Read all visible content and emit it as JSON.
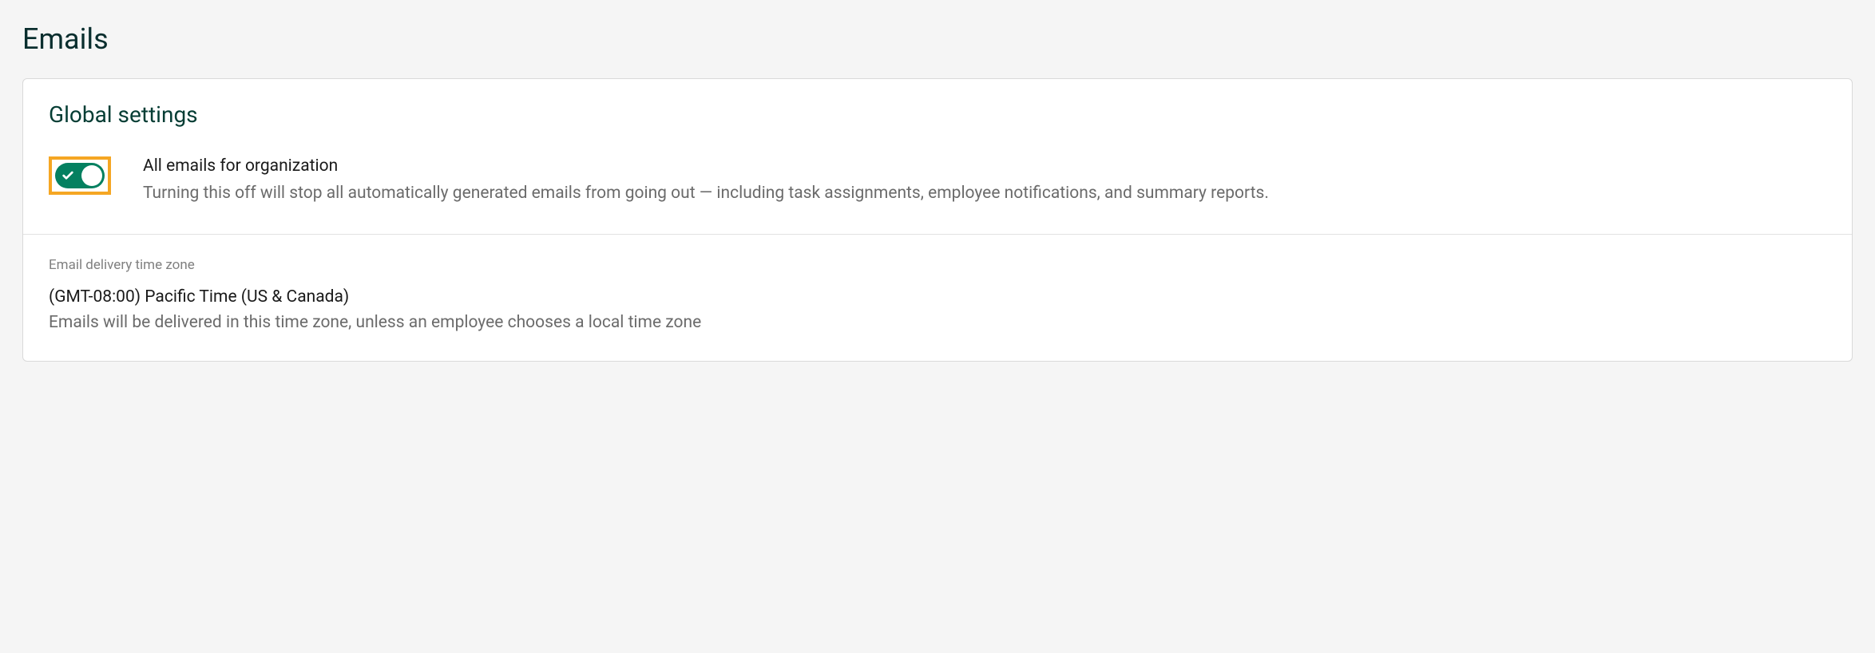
{
  "page": {
    "title": "Emails"
  },
  "globalSettings": {
    "heading": "Global settings",
    "toggle": {
      "on": true,
      "label": "All emails for organization",
      "description": "Turning this off will stop all automatically generated emails from going out — including task assignments, employee notifications, and summary reports."
    }
  },
  "timezone": {
    "label": "Email delivery time zone",
    "value": "(GMT-08:00) Pacific Time (US & Canada)",
    "description": "Emails will be delivered in this time zone, unless an employee chooses a local time zone"
  },
  "colors": {
    "accent": "#048060",
    "highlight": "#f5a623"
  }
}
